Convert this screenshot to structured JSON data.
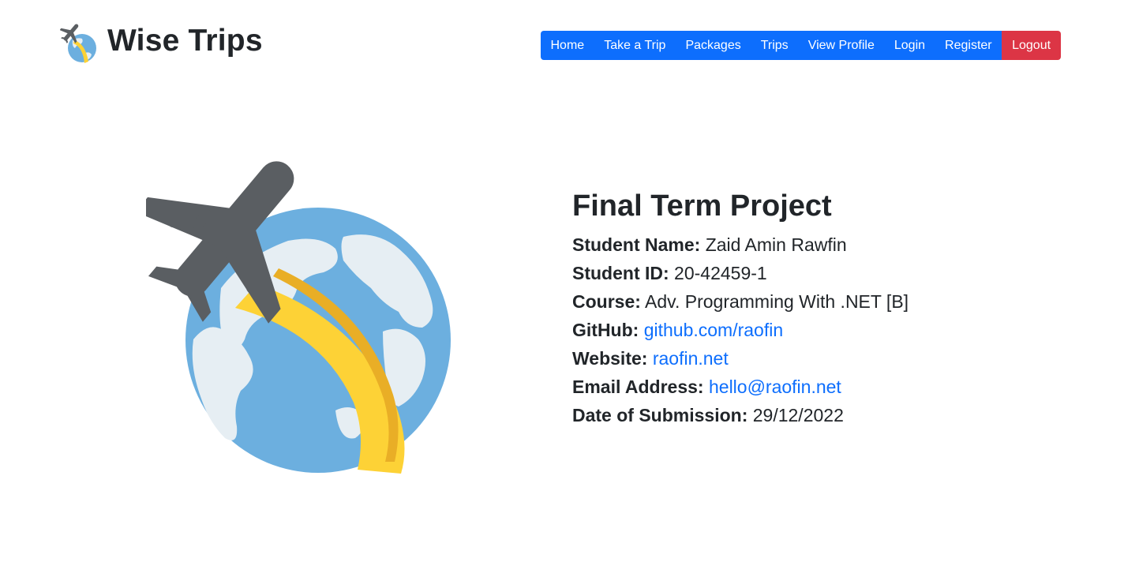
{
  "brand": {
    "name": "Wise Trips",
    "logo_icon": "plane-globe-icon"
  },
  "nav": {
    "items": [
      {
        "label": "Home"
      },
      {
        "label": "Take a Trip"
      },
      {
        "label": "Packages"
      },
      {
        "label": "Trips"
      },
      {
        "label": "View Profile"
      },
      {
        "label": "Login"
      },
      {
        "label": "Register"
      },
      {
        "label": "Logout"
      }
    ],
    "primary_color": "#0d6efd",
    "logout_color": "#dc3545"
  },
  "hero": {
    "illustration_icon": "plane-globe-illustration",
    "colors": {
      "ocean": "#6cafdf",
      "land": "#e6eef3",
      "trail": "#fdd236",
      "trail_shade": "#e9ae26",
      "plane": "#5a5e62"
    }
  },
  "project": {
    "title": "Final Term Project",
    "student_name": {
      "label": "Student Name:",
      "value": "Zaid Amin Rawfin"
    },
    "student_id": {
      "label": "Student ID:",
      "value": "20-42459-1"
    },
    "course": {
      "label": "Course:",
      "value": "Adv. Programming With .NET [B]"
    },
    "github": {
      "label": "GitHub:",
      "value": "github.com/raofin"
    },
    "website": {
      "label": "Website:",
      "value": "raofin.net"
    },
    "email": {
      "label": "Email Address:",
      "value": "hello@raofin.net"
    },
    "submission_date": {
      "label": "Date of Submission:",
      "value": "29/12/2022"
    }
  }
}
